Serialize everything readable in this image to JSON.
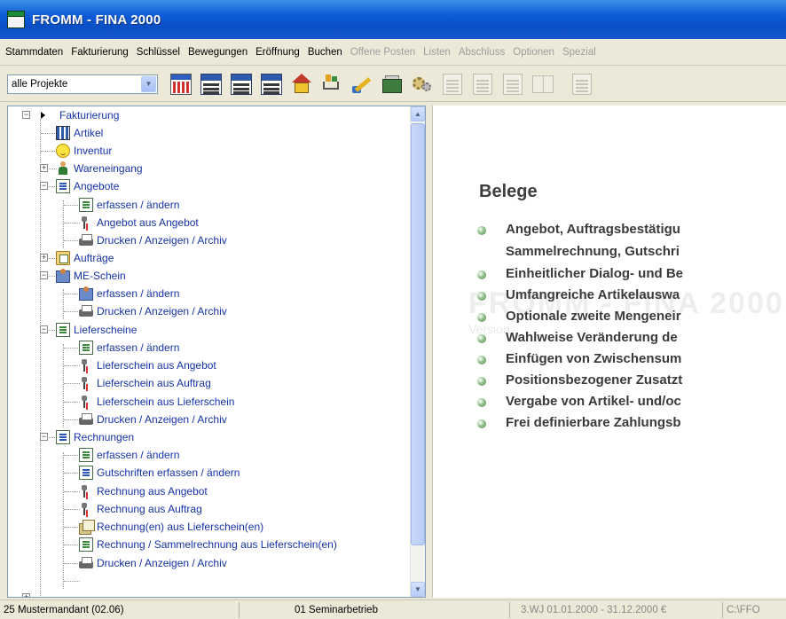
{
  "window": {
    "title": "FROMM - FINA 2000"
  },
  "menu": [
    {
      "label": "Stammdaten",
      "enabled": true
    },
    {
      "label": "Fakturierung",
      "enabled": true
    },
    {
      "label": "Schlüssel",
      "enabled": true
    },
    {
      "label": "Bewegungen",
      "enabled": true
    },
    {
      "label": "Eröffnung",
      "enabled": true
    },
    {
      "label": "Buchen",
      "enabled": true
    },
    {
      "label": "Offene Posten",
      "enabled": false
    },
    {
      "label": "Listen",
      "enabled": false
    },
    {
      "label": "Abschluss",
      "enabled": false
    },
    {
      "label": "Optionen",
      "enabled": false
    },
    {
      "label": "Spezial",
      "enabled": false
    }
  ],
  "toolbar": {
    "project_select": {
      "value": "alle Projekte"
    },
    "buttons": [
      {
        "icon": "calendar-icon",
        "enabled": true
      },
      {
        "icon": "journal-list-icon",
        "enabled": true
      },
      {
        "icon": "account-list-icon",
        "enabled": true
      },
      {
        "icon": "cost-list-icon",
        "enabled": true
      },
      {
        "icon": "house-icon",
        "enabled": true
      },
      {
        "icon": "shopping-cart-icon",
        "enabled": true
      },
      {
        "icon": "pen-icon",
        "enabled": true
      },
      {
        "icon": "cash-register-icon",
        "enabled": true
      },
      {
        "icon": "gears-icon",
        "enabled": true
      },
      {
        "icon": "document-icon",
        "enabled": false
      },
      {
        "icon": "document-icon",
        "enabled": false
      },
      {
        "icon": "document-icon",
        "enabled": false
      },
      {
        "icon": "book-icon",
        "enabled": false
      },
      {
        "icon": "document-icon",
        "enabled": false
      }
    ]
  },
  "tree": {
    "root": "Fakturierung",
    "items": {
      "artikel": "Artikel",
      "inventur": "Inventur",
      "wareneingang": "Wareneingang",
      "angebote": "Angebote",
      "ang_erfassen": "erfassen / ändern",
      "ang_aus_angebot": "Angebot aus Angebot",
      "ang_drucken": "Drucken / Anzeigen / Archiv",
      "auftraege": "Aufträge",
      "me_schein": "ME-Schein",
      "me_erfassen": "erfassen / ändern",
      "me_drucken": "Drucken / Anzeigen / Archiv",
      "lieferscheine": "Lieferscheine",
      "ls_erfassen": "erfassen / ändern",
      "ls_aus_angebot": "Lieferschein aus Angebot",
      "ls_aus_auftrag": "Lieferschein aus Auftrag",
      "ls_aus_ls": "Lieferschein aus Lieferschein",
      "ls_drucken": "Drucken / Anzeigen / Archiv",
      "rechnungen": "Rechnungen",
      "re_erfassen": "erfassen / ändern",
      "re_gutschriften": "Gutschriften erfassen / ändern",
      "re_aus_angebot": "Rechnung aus Angebot",
      "re_aus_auftrag": "Rechnung aus Auftrag",
      "re_aus_ls": "Rechnung(en) aus Lieferschein(en)",
      "re_sammel": "Rechnung / Sammelrechnung aus Lieferschein(en)",
      "re_drucken": "Drucken / Anzeigen / Archiv"
    }
  },
  "info": {
    "watermark": "FROMM - FINA 2000",
    "watermark_sub": "Version",
    "title": "Belege",
    "bullets": [
      "Angebot, Auftragsbestätigu",
      "Sammelrechnung, Gutschri",
      "Einheitlicher Dialog- und Be",
      "Umfangreiche Artikelauswa",
      "Optionale zweite Mengeneir",
      "Wahlweise Veränderung de",
      "Einfügen von Zwischensum",
      "Positionsbezogener Zusatzt",
      "Vergabe von Artikel- und/oc",
      "Frei definierbare Zahlungsb"
    ]
  },
  "status": {
    "mandant": "25 Mustermandant (02.06)",
    "betrieb": "01 Seminarbetrieb",
    "periode": "3.WJ 01.01.2000 - 31.12.2000 €",
    "extra": "C:\\FFO"
  }
}
